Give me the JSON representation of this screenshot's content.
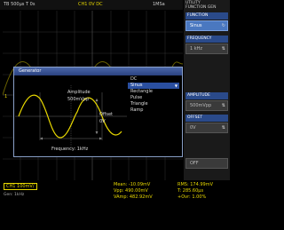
{
  "topbar": {
    "timebase": "TB 500µs T 0s",
    "channel": "CH1 0V DC",
    "sample_rate": "1MSa"
  },
  "generator": {
    "title": "Generator",
    "amplitude_label": "Amplitude",
    "amplitude_value": "500mVpp",
    "offset_label": "Offset",
    "offset_value": "0V",
    "frequency_label": "Frequency: 1kHz",
    "waveforms": [
      {
        "label": "DC",
        "selected": false
      },
      {
        "label": "Sinus",
        "selected": true
      },
      {
        "label": "Rectangle",
        "selected": false
      },
      {
        "label": "Pulse",
        "selected": false
      },
      {
        "label": "Triangle",
        "selected": false
      },
      {
        "label": "Ramp",
        "selected": false
      }
    ]
  },
  "sidebar": {
    "header_line1": "UTILITY",
    "header_line2": "FUNCTION GEN",
    "function_label": "FUNCTION",
    "function_value": "Sinus",
    "frequency_label": "FREQUENCY",
    "frequency_value": "1 kHz",
    "amplitude_label": "AMPLITUDE",
    "amplitude_value": "500mVpp",
    "offset_label": "OFFSET",
    "offset_value": "0V",
    "off_label": "OFF"
  },
  "bottom": {
    "channel_box": "CH1 100mV/",
    "gen_status": "Gen: 1kHz",
    "mean": "Mean: -10.09mV",
    "vpp": "Vpp: 490.00mV",
    "vamp": "VAmp: 482.92mV",
    "rms": "RMS: 174.99mV",
    "period": "T: 285.60µs",
    "overshoot": "+Ovr: 1.00%"
  },
  "colors": {
    "channel": "#e8d800",
    "accent": "#2a4fa0",
    "dialog_border": "#8aa0c8"
  }
}
